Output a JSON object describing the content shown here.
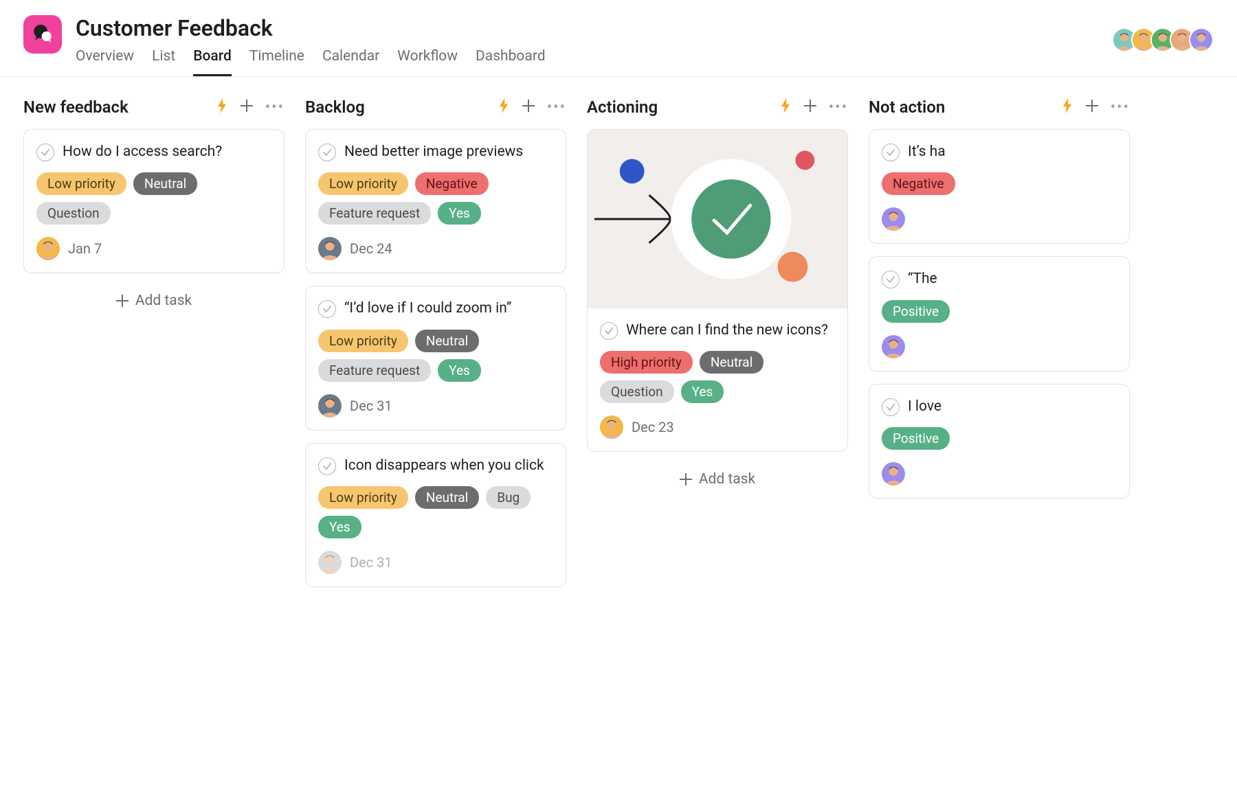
{
  "project": {
    "title": "Customer Feedback"
  },
  "tabs": [
    {
      "label": "Overview",
      "active": false
    },
    {
      "label": "List",
      "active": false
    },
    {
      "label": "Board",
      "active": true
    },
    {
      "label": "Timeline",
      "active": false
    },
    {
      "label": "Calendar",
      "active": false
    },
    {
      "label": "Workflow",
      "active": false
    },
    {
      "label": "Dashboard",
      "active": false
    }
  ],
  "members": [
    {
      "bg": "#7bc9c0"
    },
    {
      "bg": "#f2b84b"
    },
    {
      "bg": "#58b368"
    },
    {
      "bg": "#e8a87c"
    },
    {
      "bg": "#9b8cf0"
    }
  ],
  "add_task_label": "Add task",
  "tag_styles": {
    "Low priority": {
      "bg": "#f6c66f",
      "fg": "#4a3a12"
    },
    "High priority": {
      "bg": "#ef6e6e",
      "fg": "#5b1414"
    },
    "Neutral": {
      "bg": "#6b6d6f",
      "fg": "#ffffff"
    },
    "Negative": {
      "bg": "#ef6e6e",
      "fg": "#5b1414"
    },
    "Positive": {
      "bg": "#58b086",
      "fg": "#ffffff"
    },
    "Question": {
      "bg": "#d9dbdd",
      "fg": "#4a4a4a"
    },
    "Feature request": {
      "bg": "#d9dbdd",
      "fg": "#4a4a4a"
    },
    "Bug": {
      "bg": "#d9dbdd",
      "fg": "#4a4a4a"
    },
    "Yes": {
      "bg": "#58b086",
      "fg": "#ffffff"
    }
  },
  "columns": [
    {
      "title": "New feedback",
      "cards": [
        {
          "title": "How do I access search?",
          "tags": [
            "Low priority",
            "Neutral",
            "Question"
          ],
          "assignee_bg": "#f2b84b",
          "date": "Jan 7"
        }
      ],
      "show_add": true
    },
    {
      "title": "Backlog",
      "cards": [
        {
          "title": "Need better image previews",
          "tags": [
            "Low priority",
            "Negative",
            "Feature request",
            "Yes"
          ],
          "assignee_bg": "#6a7a8a",
          "date": "Dec 24"
        },
        {
          "title": "“I’d love if I could zoom in”",
          "tags": [
            "Low priority",
            "Neutral",
            "Feature request",
            "Yes"
          ],
          "assignee_bg": "#6a7a8a",
          "date": "Dec 31"
        },
        {
          "title": "Icon disappears when you click",
          "tags": [
            "Low priority",
            "Neutral",
            "Bug",
            "Yes"
          ],
          "assignee_bg": "#bfbfbf",
          "date": "Dec 31",
          "faded_footer": true
        }
      ],
      "show_add": false
    },
    {
      "title": "Actioning",
      "cards": [
        {
          "cover": true,
          "title": "Where can I find the new icons?",
          "tags": [
            "High priority",
            "Neutral",
            "Question",
            "Yes"
          ],
          "assignee_bg": "#f2b84b",
          "date": "Dec 23"
        }
      ],
      "show_add": true
    },
    {
      "title": "Not action",
      "cards": [
        {
          "title": "It’s ha",
          "tags": [
            "Negative"
          ],
          "assignee_bg": "#9b8cf0",
          "date": ""
        },
        {
          "title": "“The ",
          "tags": [
            "Positive"
          ],
          "assignee_bg": "#9b8cf0",
          "date": ""
        },
        {
          "title": "I love",
          "tags": [
            "Positive"
          ],
          "assignee_bg": "#9b8cf0",
          "date": ""
        }
      ],
      "show_add": false
    }
  ]
}
